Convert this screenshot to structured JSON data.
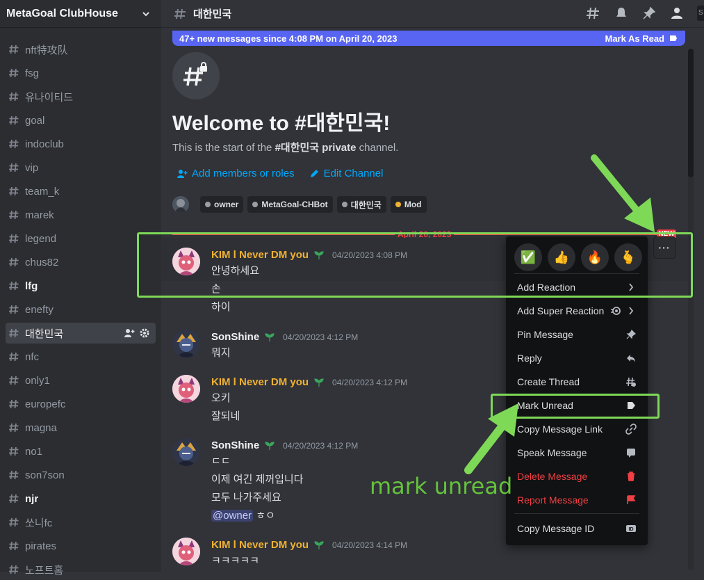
{
  "server": {
    "name": "MetaGoal ClubHouse"
  },
  "channels": [
    {
      "name": "nft特攻队",
      "bold": false,
      "active": false
    },
    {
      "name": "fsg",
      "bold": false,
      "active": false
    },
    {
      "name": "유나이티드",
      "bold": false,
      "active": false
    },
    {
      "name": "goal",
      "bold": false,
      "active": false
    },
    {
      "name": "indoclub",
      "bold": false,
      "active": false
    },
    {
      "name": "vip",
      "bold": false,
      "active": false
    },
    {
      "name": "team_k",
      "bold": false,
      "active": false
    },
    {
      "name": "marek",
      "bold": false,
      "active": false
    },
    {
      "name": "legend",
      "bold": false,
      "active": false
    },
    {
      "name": "chus82",
      "bold": false,
      "active": false
    },
    {
      "name": "lfg",
      "bold": true,
      "active": false
    },
    {
      "name": "enefty",
      "bold": false,
      "active": false
    },
    {
      "name": "대한민국",
      "bold": false,
      "active": true
    },
    {
      "name": "nfc",
      "bold": false,
      "active": false
    },
    {
      "name": "only1",
      "bold": false,
      "active": false
    },
    {
      "name": "europefc",
      "bold": false,
      "active": false
    },
    {
      "name": "magna",
      "bold": false,
      "active": false
    },
    {
      "name": "no1",
      "bold": false,
      "active": false
    },
    {
      "name": "son7son",
      "bold": false,
      "active": false
    },
    {
      "name": "njr",
      "bold": true,
      "active": false
    },
    {
      "name": "쏘니fc",
      "bold": false,
      "active": false
    },
    {
      "name": "pirates",
      "bold": false,
      "active": false
    },
    {
      "name": "노프트홈",
      "bold": false,
      "active": false
    }
  ],
  "topbar": {
    "channel_name": "대한민국",
    "search_stub": "S"
  },
  "banner": {
    "text": "47+ new messages since 4:08 PM on April 20, 2023",
    "mark_label": "Mark As Read"
  },
  "welcome": {
    "title": "Welcome to #대한민국!",
    "sub_prefix": "This is the start of the ",
    "sub_channel": "#대한민국",
    "sub_private": "private",
    "sub_suffix": " channel.",
    "add_members": "Add members or roles",
    "edit_channel": "Edit Channel"
  },
  "roles": [
    {
      "name": "owner",
      "color": "#9b9ea4"
    },
    {
      "name": "MetaGoal-CHBot",
      "color": "#9b9ea4"
    },
    {
      "name": "대한민국",
      "color": "#9b9ea4"
    },
    {
      "name": "Mod",
      "color": "#f0b232"
    }
  ],
  "divider": {
    "date": "April 20, 2023",
    "new_label": "NEW"
  },
  "messages": [
    {
      "author": "KIM l Never DM you",
      "time": "04/20/2023 4:08 PM",
      "lines": [
        "안녕하세요",
        "손",
        "하이"
      ]
    },
    {
      "author": "SonShine",
      "time": "04/20/2023 4:12 PM",
      "lines": [
        "뭐지"
      ]
    },
    {
      "author": "KIM l Never DM you",
      "time": "04/20/2023 4:12 PM",
      "lines": [
        "오키",
        "잘되네"
      ]
    },
    {
      "author": "SonShine",
      "time": "04/20/2023 4:12 PM",
      "lines": [
        "ㄷㄷ",
        "이제 여긴 제꺼입니다",
        "모두 나가주세요"
      ],
      "mention": "@owner",
      "mention_after": " ㅎㅇ"
    },
    {
      "author": "KIM l Never DM you",
      "time": "04/20/2023 4:14 PM",
      "lines": [
        "ㅋㅋㅋㅋㅋ"
      ]
    }
  ],
  "toolbar": {
    "more_label": "···"
  },
  "context_menu": {
    "reactions": [
      "✅",
      "👍",
      "🔥",
      "🫰"
    ],
    "items": [
      {
        "label": "Add Reaction",
        "icon": "chevron-right-icon",
        "danger": false
      },
      {
        "label": "Add Super Reaction",
        "icon": "chevron-right-icon",
        "danger": false
      },
      {
        "label": "Pin Message",
        "icon": "pin-icon",
        "danger": false
      },
      {
        "label": "Reply",
        "icon": "reply-icon",
        "danger": false
      },
      {
        "label": "Create Thread",
        "icon": "thread-icon",
        "danger": false
      },
      {
        "label": "Mark Unread",
        "icon": "mark-unread-icon",
        "danger": false
      },
      {
        "label": "Copy Message Link",
        "icon": "link-icon",
        "danger": false
      },
      {
        "label": "Speak Message",
        "icon": "speak-icon",
        "danger": false
      },
      {
        "label": "Delete Message",
        "icon": "trash-icon",
        "danger": true
      },
      {
        "label": "Report Message",
        "icon": "flag-icon",
        "danger": true
      },
      {
        "label": "Copy Message ID",
        "icon": "id-icon",
        "danger": false
      }
    ]
  },
  "annotation": {
    "text": "mark unread",
    "color": "#65c23c"
  },
  "colors": {
    "accent": "#5865f2",
    "annotation_green": "#7ed957",
    "danger": "#f23f43",
    "kim_name": "#f0b232"
  }
}
